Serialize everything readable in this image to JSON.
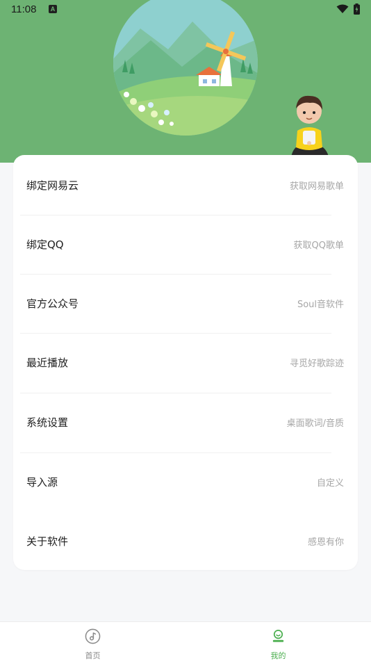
{
  "status_bar": {
    "time": "11:08",
    "notification_letter": "A"
  },
  "menu": [
    {
      "label": "绑定网易云",
      "hint": "获取网易歌单"
    },
    {
      "label": "绑定QQ",
      "hint": "获取QQ歌单"
    },
    {
      "label": "官方公众号",
      "hint": "Soul音软件"
    },
    {
      "label": "最近播放",
      "hint": "寻觅好歌踪迹"
    },
    {
      "label": "系统设置",
      "hint": "桌面歌词/音质"
    },
    {
      "label": "导入源",
      "hint": "自定义"
    },
    {
      "label": "关于软件",
      "hint": "感恩有你"
    }
  ],
  "bottom_nav": {
    "tabs": [
      {
        "label": "首页",
        "icon": "music-disc-icon",
        "active": false
      },
      {
        "label": "我的",
        "icon": "profile-icon",
        "active": true
      }
    ]
  },
  "colors": {
    "header": "#6db373",
    "accent": "#4caf50",
    "inactive": "#888888"
  }
}
